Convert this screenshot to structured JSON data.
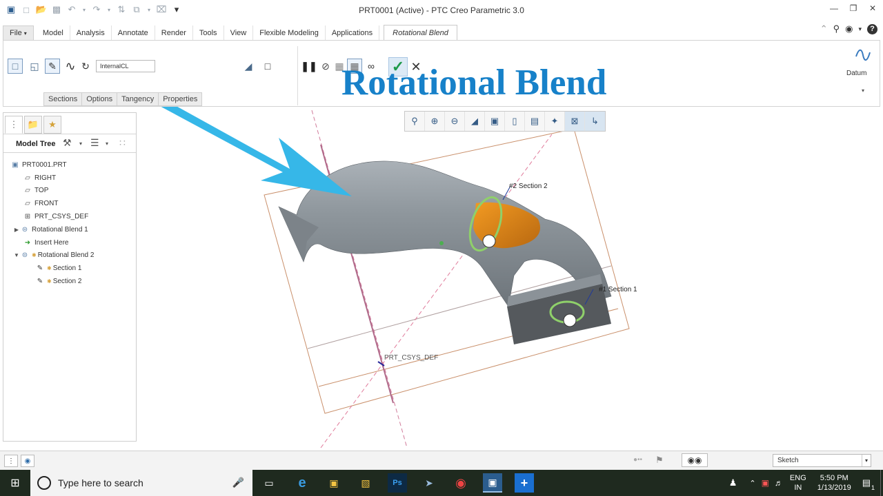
{
  "window": {
    "title": "PRT0001 (Active) - PTC Creo Parametric 3.0",
    "controls": [
      "minimize-icon",
      "restore-icon",
      "close-icon"
    ]
  },
  "quick_access": [
    "app-icon",
    "new-icon",
    "open-icon",
    "save-icon",
    "undo-icon",
    "redo-icon",
    "regenerate-icon",
    "windows-icon",
    "close-window-icon",
    "customize-icon"
  ],
  "tabs": [
    {
      "label": "File"
    },
    {
      "label": "Model"
    },
    {
      "label": "Analysis"
    },
    {
      "label": "Annotate"
    },
    {
      "label": "Render"
    },
    {
      "label": "Tools"
    },
    {
      "label": "View"
    },
    {
      "label": "Flexible Modeling"
    },
    {
      "label": "Applications"
    },
    {
      "label": "Rotational Blend"
    }
  ],
  "ribbon": {
    "axis_reference_value": "InternalCL",
    "sub_tabs": [
      "Sections",
      "Options",
      "Tangency",
      "Properties"
    ],
    "datum_label": "Datum"
  },
  "overlay": {
    "title": "Rotational Blend"
  },
  "model_tree": {
    "label": "Model Tree",
    "items": [
      {
        "label": "PRT0001.PRT"
      },
      {
        "label": "RIGHT"
      },
      {
        "label": "TOP"
      },
      {
        "label": "FRONT"
      },
      {
        "label": "PRT_CSYS_DEF"
      },
      {
        "label": "Rotational Blend 1"
      },
      {
        "label": "Insert Here"
      },
      {
        "label": "Rotational Blend 2"
      },
      {
        "label": "Section 1"
      },
      {
        "label": "Section 2"
      }
    ]
  },
  "viewport": {
    "labels": {
      "section2": "#2 Section 2",
      "section1": "#1 Section 1",
      "csys": "PRT_CSYS_DEF"
    },
    "colors": {
      "body": "#8c949a",
      "cut_surface": "#e08a1c",
      "section_ring": "#8fd06a",
      "datum_line": "#c97a6a",
      "pointer_arrow": "#36b7e8"
    }
  },
  "statusbar": {
    "filter_value": "Sketch"
  },
  "taskbar": {
    "search_placeholder": "Type here to search",
    "language_line1": "ENG",
    "language_line2": "IN",
    "time": "5:50 PM",
    "date": "1/13/2019",
    "notification_count": "1"
  }
}
